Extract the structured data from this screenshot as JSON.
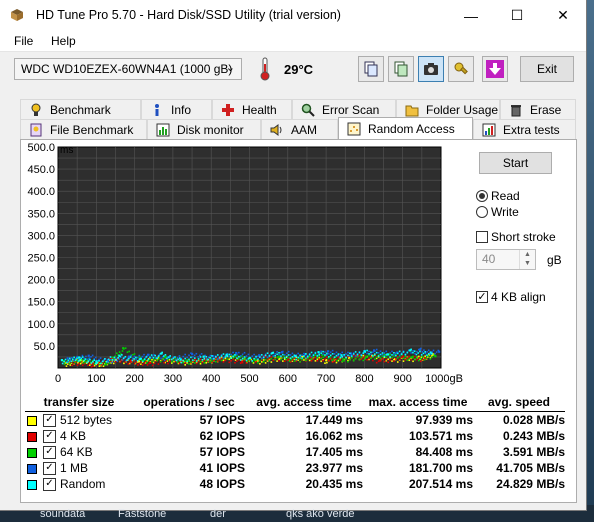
{
  "window": {
    "title": "HD Tune Pro 5.70 - Hard Disk/SSD Utility (trial version)",
    "minimize": "—",
    "maximize": "☐",
    "close": "✕"
  },
  "menu": {
    "file": "File",
    "help": "Help"
  },
  "toolbar": {
    "drive": "WDC WD10EZEX-60WN4A1 (1000 gB)",
    "temperature": "29°C",
    "exit": "Exit"
  },
  "tabs_row1": [
    "Benchmark",
    "Info",
    "Health",
    "Error Scan",
    "Folder Usage",
    "Erase"
  ],
  "tabs_row2": [
    "File Benchmark",
    "Disk monitor",
    "AAM",
    "Random Access",
    "Extra tests"
  ],
  "controls": {
    "start": "Start",
    "read": "Read",
    "write": "Write",
    "short_stroke": "Short stroke",
    "stroke_value": "40",
    "stroke_unit": "gB",
    "align": "4 KB align",
    "read_selected": true,
    "short_stroke_checked": false,
    "align_checked": true
  },
  "results": {
    "headers": [
      "transfer size",
      "operations / sec",
      "avg. access time",
      "max. access time",
      "avg. speed"
    ],
    "rows": [
      {
        "size": "512 bytes",
        "color": "#ffff00",
        "ops": "57 IOPS",
        "avg": "17.449 ms",
        "max": "97.939 ms",
        "speed": "0.028 MB/s"
      },
      {
        "size": "4 KB",
        "color": "#e00000",
        "ops": "62 IOPS",
        "avg": "16.062 ms",
        "max": "103.571 ms",
        "speed": "0.243 MB/s"
      },
      {
        "size": "64 KB",
        "color": "#00d000",
        "ops": "57 IOPS",
        "avg": "17.405 ms",
        "max": "84.408 ms",
        "speed": "3.591 MB/s"
      },
      {
        "size": "1 MB",
        "color": "#1060e0",
        "ops": "41 IOPS",
        "avg": "23.977 ms",
        "max": "181.700 ms",
        "speed": "41.705 MB/s"
      },
      {
        "size": "Random",
        "color": "#00ffff",
        "ops": "48 IOPS",
        "avg": "20.435 ms",
        "max": "207.514 ms",
        "speed": "24.829 MB/s"
      }
    ]
  },
  "chart_data": {
    "type": "scatter",
    "ylabel": "ms",
    "xlabel": "",
    "x_ticks": [
      "0",
      "100",
      "200",
      "300",
      "400",
      "500",
      "600",
      "700",
      "800",
      "900",
      "1000gB"
    ],
    "y_ticks": [
      "50.0",
      "100.0",
      "150.0",
      "200.0",
      "250.0",
      "300.0",
      "350.0",
      "400.0",
      "450.0",
      "500.0"
    ],
    "xlim": [
      0,
      1000
    ],
    "ylim": [
      0,
      500
    ],
    "grid": true,
    "series": [
      {
        "color": "#ffff00",
        "points": [
          [
            20,
            12
          ],
          [
            60,
            18
          ],
          [
            110,
            9
          ],
          [
            150,
            20
          ],
          [
            210,
            15
          ],
          [
            260,
            22
          ],
          [
            330,
            14
          ],
          [
            390,
            19
          ],
          [
            450,
            25
          ],
          [
            520,
            17
          ],
          [
            580,
            21
          ],
          [
            640,
            26
          ],
          [
            700,
            18
          ],
          [
            760,
            23
          ],
          [
            820,
            28
          ],
          [
            880,
            20
          ],
          [
            940,
            24
          ],
          [
            980,
            30
          ]
        ]
      },
      {
        "color": "#e00000",
        "points": [
          [
            35,
            14
          ],
          [
            90,
            10
          ],
          [
            140,
            22
          ],
          [
            190,
            16
          ],
          [
            240,
            12
          ],
          [
            300,
            20
          ],
          [
            360,
            17
          ],
          [
            420,
            23
          ],
          [
            480,
            15
          ],
          [
            540,
            27
          ],
          [
            600,
            19
          ],
          [
            660,
            24
          ],
          [
            720,
            21
          ],
          [
            780,
            29
          ],
          [
            840,
            18
          ],
          [
            900,
            26
          ],
          [
            960,
            22
          ]
        ]
      },
      {
        "color": "#00d000",
        "points": [
          [
            15,
            16
          ],
          [
            70,
            20
          ],
          [
            125,
            12
          ],
          [
            170,
            45
          ],
          [
            225,
            18
          ],
          [
            280,
            24
          ],
          [
            340,
            16
          ],
          [
            400,
            21
          ],
          [
            460,
            28
          ],
          [
            515,
            19
          ],
          [
            575,
            25
          ],
          [
            630,
            22
          ],
          [
            690,
            30
          ],
          [
            745,
            20
          ],
          [
            805,
            26
          ],
          [
            865,
            31
          ],
          [
            925,
            24
          ],
          [
            985,
            27
          ]
        ]
      },
      {
        "color": "#1060e0",
        "points": [
          [
            25,
            22
          ],
          [
            80,
            28
          ],
          [
            130,
            18
          ],
          [
            185,
            26
          ],
          [
            235,
            30
          ],
          [
            290,
            24
          ],
          [
            350,
            32
          ],
          [
            405,
            27
          ],
          [
            465,
            34
          ],
          [
            525,
            29
          ],
          [
            585,
            36
          ],
          [
            645,
            31
          ],
          [
            705,
            38
          ],
          [
            765,
            33
          ],
          [
            825,
            40
          ],
          [
            885,
            35
          ],
          [
            945,
            42
          ],
          [
            995,
            37
          ]
        ]
      },
      {
        "color": "#00ffff",
        "points": [
          [
            10,
            18
          ],
          [
            55,
            24
          ],
          [
            100,
            15
          ],
          [
            160,
            28
          ],
          [
            215,
            21
          ],
          [
            270,
            33
          ],
          [
            320,
            19
          ],
          [
            380,
            26
          ],
          [
            440,
            30
          ],
          [
            500,
            23
          ],
          [
            560,
            34
          ],
          [
            620,
            27
          ],
          [
            680,
            36
          ],
          [
            740,
            29
          ],
          [
            800,
            38
          ],
          [
            860,
            31
          ],
          [
            920,
            40
          ],
          [
            975,
            33
          ]
        ]
      }
    ]
  }
}
